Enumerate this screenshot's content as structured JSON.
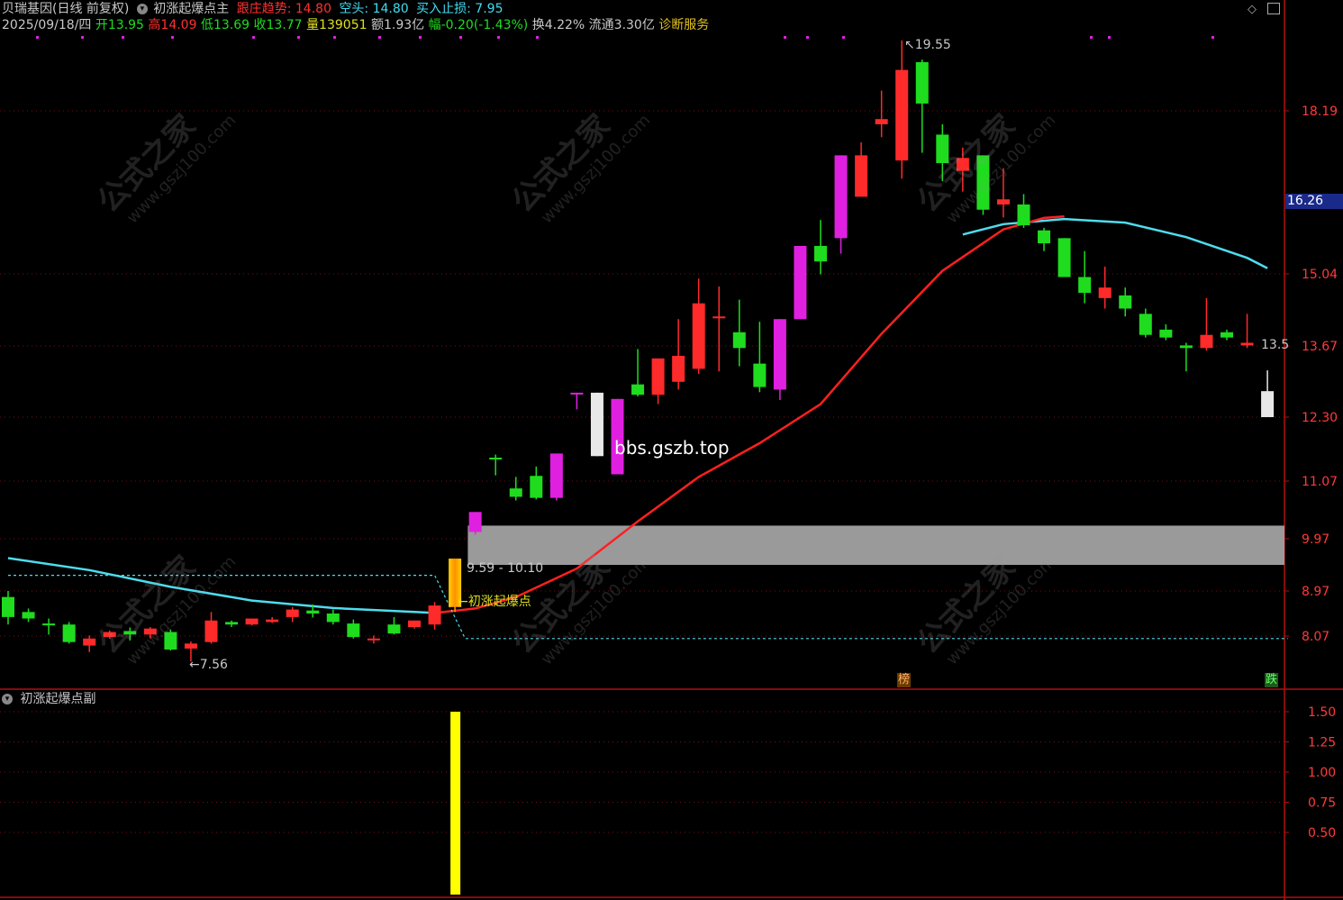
{
  "header": {
    "stock_name": "贝瑞基因(日线 前复权)",
    "indicator_name": "初涨起爆点主",
    "trend_label": "跟庄趋势: 14.80",
    "short_label": "空头: 14.80",
    "stop_label": "买入止损: 7.95",
    "date": "2025/09/18/四",
    "open": "开13.95",
    "high": "高14.09",
    "low": "低13.69",
    "close": "收13.77",
    "volume": "量139051",
    "amount": "额1.93亿",
    "change": "幅-0.20(-1.43%)",
    "turnover": "换4.22%",
    "float_cap": "流通3.30亿",
    "service": "诊断服务"
  },
  "sub_panel": {
    "title": "初涨起爆点副"
  },
  "annotations": {
    "high_marker": "19.55",
    "low_marker": "7.56",
    "range_label": "9.59 - 10.10",
    "signal_label": "初涨起爆点",
    "site_text": "bbs.gszb.top",
    "last_price_label": "13.5",
    "current_price_tag": "16.26",
    "badge_bang": "榜",
    "badge_die": "跌"
  },
  "watermark": {
    "title": "公式之家",
    "url": "www.gszj100.com"
  },
  "colors": {
    "up": "#ff2a2a",
    "down": "#1fdc1f",
    "magenta": "#e020e0",
    "white_candle": "#e8e8e8",
    "cyan_line": "#4fdcee",
    "red_line": "#ff2020",
    "band": "#9a9a9a",
    "signal_bar": "#ffff00",
    "axis": "#b01010",
    "price_tag_bg": "#1a2a8a"
  },
  "chart_data": {
    "type": "candlestick",
    "y_axis": {
      "ticks": [
        18.19,
        15.04,
        13.67,
        12.3,
        11.07,
        9.97,
        8.97,
        8.07
      ],
      "ylim": [
        7.1,
        20.2
      ]
    },
    "sub_y_axis": {
      "ticks": [
        1.5,
        1.25,
        1.0,
        0.75,
        0.5
      ],
      "ylim": [
        0,
        1.65
      ]
    },
    "candles": [
      {
        "o": 8.45,
        "h": 8.97,
        "l": 8.3,
        "c": 8.85,
        "t": "g"
      },
      {
        "o": 8.42,
        "h": 8.62,
        "l": 8.35,
        "c": 8.55,
        "t": "g"
      },
      {
        "o": 8.3,
        "h": 8.42,
        "l": 8.1,
        "c": 8.32,
        "t": "g"
      },
      {
        "o": 7.95,
        "h": 8.35,
        "l": 7.92,
        "c": 8.3,
        "t": "g"
      },
      {
        "o": 8.02,
        "h": 8.08,
        "l": 7.75,
        "c": 7.88,
        "t": "r"
      },
      {
        "o": 8.05,
        "h": 8.18,
        "l": 8.02,
        "c": 8.15,
        "t": "r"
      },
      {
        "o": 8.1,
        "h": 8.24,
        "l": 7.98,
        "c": 8.17,
        "t": "g"
      },
      {
        "o": 8.1,
        "h": 8.25,
        "l": 8.02,
        "c": 8.22,
        "t": "r"
      },
      {
        "o": 7.8,
        "h": 8.2,
        "l": 7.78,
        "c": 8.15,
        "t": "g"
      },
      {
        "o": 7.92,
        "h": 7.96,
        "l": 7.56,
        "c": 7.82,
        "t": "r"
      },
      {
        "o": 7.95,
        "h": 8.55,
        "l": 7.92,
        "c": 8.38,
        "t": "r"
      },
      {
        "o": 8.3,
        "h": 8.38,
        "l": 8.25,
        "c": 8.35,
        "t": "g"
      },
      {
        "o": 8.3,
        "h": 8.4,
        "l": 8.28,
        "c": 8.42,
        "t": "r"
      },
      {
        "o": 8.35,
        "h": 8.45,
        "l": 8.33,
        "c": 8.4,
        "t": "r"
      },
      {
        "o": 8.45,
        "h": 8.65,
        "l": 8.35,
        "c": 8.6,
        "t": "r"
      },
      {
        "o": 8.52,
        "h": 8.7,
        "l": 8.44,
        "c": 8.58,
        "t": "g"
      },
      {
        "o": 8.35,
        "h": 8.6,
        "l": 8.3,
        "c": 8.52,
        "t": "g"
      },
      {
        "o": 8.05,
        "h": 8.4,
        "l": 8.02,
        "c": 8.32,
        "t": "g"
      },
      {
        "o": 8.0,
        "h": 8.08,
        "l": 7.92,
        "c": 8.02,
        "t": "r"
      },
      {
        "o": 8.12,
        "h": 8.45,
        "l": 8.1,
        "c": 8.3,
        "t": "g"
      },
      {
        "o": 8.25,
        "h": 8.38,
        "l": 8.22,
        "c": 8.38,
        "t": "r"
      },
      {
        "o": 8.3,
        "h": 8.75,
        "l": 8.2,
        "c": 8.68,
        "t": "r"
      },
      {
        "o": 8.65,
        "h": 9.59,
        "l": 8.55,
        "c": 9.59,
        "t": "o"
      },
      {
        "o": 10.1,
        "h": 10.48,
        "l": 10.05,
        "c": 10.48,
        "t": "m"
      },
      {
        "o": 11.52,
        "h": 11.58,
        "l": 11.18,
        "c": 11.52,
        "t": "g"
      },
      {
        "o": 10.77,
        "h": 11.15,
        "l": 10.7,
        "c": 10.93,
        "t": "g"
      },
      {
        "o": 10.75,
        "h": 11.35,
        "l": 10.72,
        "c": 11.17,
        "t": "g"
      },
      {
        "o": 10.75,
        "h": 11.6,
        "l": 10.7,
        "c": 11.6,
        "t": "m"
      },
      {
        "o": 12.77,
        "h": 12.77,
        "l": 12.45,
        "c": 12.77,
        "t": "m"
      },
      {
        "o": 11.55,
        "h": 12.77,
        "l": 11.55,
        "c": 12.77,
        "t": "w"
      },
      {
        "o": 11.2,
        "h": 12.65,
        "l": 11.2,
        "c": 12.65,
        "t": "m"
      },
      {
        "o": 12.73,
        "h": 13.61,
        "l": 12.7,
        "c": 12.93,
        "t": "g"
      },
      {
        "o": 12.73,
        "h": 13.43,
        "l": 12.55,
        "c": 13.43,
        "t": "r"
      },
      {
        "o": 12.98,
        "h": 14.18,
        "l": 12.83,
        "c": 13.48,
        "t": "r"
      },
      {
        "o": 13.23,
        "h": 14.95,
        "l": 13.13,
        "c": 14.48,
        "t": "r"
      },
      {
        "o": 14.23,
        "h": 14.8,
        "l": 13.18,
        "c": 14.23,
        "t": "r"
      },
      {
        "o": 13.63,
        "h": 14.55,
        "l": 13.28,
        "c": 13.93,
        "t": "g"
      },
      {
        "o": 12.88,
        "h": 14.13,
        "l": 12.78,
        "c": 13.33,
        "t": "g"
      },
      {
        "o": 12.83,
        "h": 14.18,
        "l": 12.63,
        "c": 14.18,
        "t": "m"
      },
      {
        "o": 14.18,
        "h": 15.58,
        "l": 14.18,
        "c": 15.58,
        "t": "m"
      },
      {
        "o": 15.28,
        "h": 16.08,
        "l": 15.03,
        "c": 15.58,
        "t": "g"
      },
      {
        "o": 15.73,
        "h": 17.33,
        "l": 15.43,
        "c": 17.33,
        "t": "m"
      },
      {
        "o": 16.53,
        "h": 17.58,
        "l": 16.53,
        "c": 17.33,
        "t": "r"
      },
      {
        "o": 17.93,
        "h": 18.58,
        "l": 17.68,
        "c": 18.03,
        "t": "r"
      },
      {
        "o": 17.23,
        "h": 19.55,
        "l": 16.88,
        "c": 18.98,
        "t": "r"
      },
      {
        "o": 18.33,
        "h": 19.18,
        "l": 17.38,
        "c": 19.13,
        "t": "g"
      },
      {
        "o": 17.18,
        "h": 17.93,
        "l": 16.83,
        "c": 17.73,
        "t": "g"
      },
      {
        "o": 17.03,
        "h": 17.48,
        "l": 16.63,
        "c": 17.28,
        "t": "r"
      },
      {
        "o": 16.28,
        "h": 17.33,
        "l": 16.18,
        "c": 17.33,
        "t": "g"
      },
      {
        "o": 16.38,
        "h": 17.08,
        "l": 16.13,
        "c": 16.48,
        "t": "r"
      },
      {
        "o": 15.98,
        "h": 16.58,
        "l": 15.93,
        "c": 16.38,
        "t": "g"
      },
      {
        "o": 15.63,
        "h": 15.93,
        "l": 15.48,
        "c": 15.88,
        "t": "g"
      },
      {
        "o": 14.98,
        "h": 15.73,
        "l": 14.98,
        "c": 15.73,
        "t": "g"
      },
      {
        "o": 14.68,
        "h": 15.48,
        "l": 14.48,
        "c": 14.98,
        "t": "g"
      },
      {
        "o": 14.58,
        "h": 15.18,
        "l": 14.38,
        "c": 14.78,
        "t": "r"
      },
      {
        "o": 14.38,
        "h": 14.78,
        "l": 14.23,
        "c": 14.63,
        "t": "g"
      },
      {
        "o": 13.88,
        "h": 14.38,
        "l": 13.83,
        "c": 14.28,
        "t": "g"
      },
      {
        "o": 13.83,
        "h": 14.08,
        "l": 13.78,
        "c": 13.98,
        "t": "g"
      },
      {
        "o": 13.63,
        "h": 13.73,
        "l": 13.18,
        "c": 13.68,
        "t": "g"
      },
      {
        "o": 13.63,
        "h": 14.58,
        "l": 13.58,
        "c": 13.88,
        "t": "r"
      },
      {
        "o": 13.83,
        "h": 13.98,
        "l": 13.78,
        "c": 13.93,
        "t": "g"
      },
      {
        "o": 13.68,
        "h": 14.28,
        "l": 13.63,
        "c": 13.73,
        "t": "r"
      },
      {
        "o": 12.3,
        "h": 13.2,
        "l": 12.3,
        "c": 12.8,
        "t": "w"
      }
    ],
    "cyan_line": [
      [
        0,
        9.6
      ],
      [
        4,
        9.37
      ],
      [
        8,
        9.05
      ],
      [
        12,
        8.78
      ],
      [
        16,
        8.63
      ],
      [
        20,
        8.55
      ],
      [
        21,
        8.53
      ],
      [
        47,
        15.8
      ],
      [
        49,
        16.0
      ],
      [
        52,
        16.1
      ],
      [
        55,
        16.03
      ],
      [
        58,
        15.75
      ],
      [
        61,
        15.35
      ],
      [
        62,
        15.15
      ]
    ],
    "red_line": [
      [
        21,
        8.53
      ],
      [
        23,
        8.62
      ],
      [
        25,
        8.85
      ],
      [
        28,
        9.4
      ],
      [
        31,
        10.3
      ],
      [
        34,
        11.15
      ],
      [
        37,
        11.8
      ],
      [
        40,
        12.55
      ],
      [
        43,
        13.9
      ],
      [
        46,
        15.1
      ],
      [
        49,
        15.9
      ],
      [
        51,
        16.12
      ],
      [
        52,
        16.15
      ]
    ],
    "support_band": {
      "from": 22.5,
      "to": 63,
      "low": 9.59,
      "high": 10.1
    },
    "dashed_upper": [
      [
        0,
        9.27
      ],
      [
        21,
        9.27
      ],
      [
        22.5,
        8.02
      ],
      [
        63,
        8.02
      ]
    ],
    "sub_bars": [
      {
        "index": 22,
        "value": 1.5
      }
    ]
  }
}
